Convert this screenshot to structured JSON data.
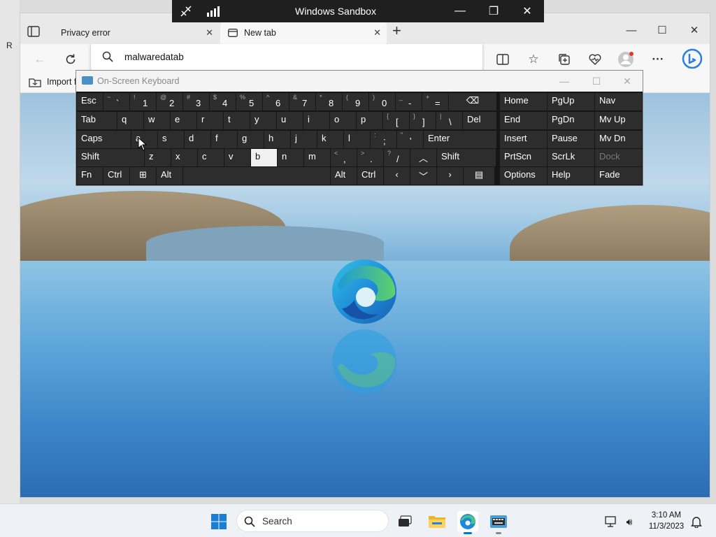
{
  "sandbox": {
    "title": "Windows Sandbox"
  },
  "desktop": {
    "left_letter": "R"
  },
  "browser": {
    "tabs": [
      {
        "label": "Privacy error",
        "active": false
      },
      {
        "label": "New tab",
        "active": true
      }
    ],
    "address": {
      "value": "malwaredatab"
    },
    "favorites_bar": {
      "import_label": "Import f"
    }
  },
  "osk": {
    "title": "On-Screen Keyboard",
    "keys": {
      "esc": "Esc",
      "tilde_s": "~",
      "tilde": "`",
      "n1s": "!",
      "n1": "1",
      "n2s": "@",
      "n2": "2",
      "n3s": "#",
      "n3": "3",
      "n4s": "$",
      "n4": "4",
      "n5s": "%",
      "n5": "5",
      "n6s": "^",
      "n6": "6",
      "n7s": "&",
      "n7": "7",
      "n8s": "*",
      "n8": "8",
      "n9s": "(",
      "n9": "9",
      "n0s": ")",
      "n0": "0",
      "minus_s": "_",
      "minus": "-",
      "eq_s": "+",
      "eq": "=",
      "tab": "Tab",
      "q": "q",
      "w": "w",
      "e": "e",
      "r": "r",
      "t": "t",
      "y": "y",
      "u": "u",
      "i": "i",
      "o": "o",
      "p": "p",
      "lb_s": "{",
      "lb": "[",
      "rb_s": "}",
      "rb": "]",
      "bs_s": "|",
      "bs": "\\",
      "del": "Del",
      "caps": "Caps",
      "a": "a",
      "s": "s",
      "d": "d",
      "f": "f",
      "g": "g",
      "h": "h",
      "j": "j",
      "k": "k",
      "l": "l",
      "semi_s": ":",
      "semi": ";",
      "quote_s": "\"",
      "quote": "'",
      "enter": "Enter",
      "shift": "Shift",
      "z": "z",
      "x": "x",
      "c": "c",
      "v": "v",
      "b": "b",
      "n": "n",
      "m": "m",
      "comma_s": "<",
      "comma": ",",
      "dot_s": ">",
      "dot": ".",
      "slash_s": "?",
      "slash": "/",
      "shift_r": "Shift",
      "fn": "Fn",
      "ctrl": "Ctrl",
      "alt": "Alt",
      "alt_r": "Alt",
      "ctrl_r": "Ctrl",
      "home": "Home",
      "pgup": "PgUp",
      "nav": "Nav",
      "end": "End",
      "pgdn": "PgDn",
      "mvup": "Mv Up",
      "insert": "Insert",
      "pause": "Pause",
      "mvdn": "Mv Dn",
      "prtscn": "PrtScn",
      "scrlk": "ScrLk",
      "dock": "Dock",
      "options": "Options",
      "help": "Help",
      "fade": "Fade"
    }
  },
  "taskbar": {
    "search_placeholder": "Search",
    "time": "3:10 AM",
    "date": "11/3/2023"
  },
  "colors": {
    "accent": "#0078d4",
    "osk_key": "#2d2d2d",
    "osk_bg": "#161616"
  }
}
